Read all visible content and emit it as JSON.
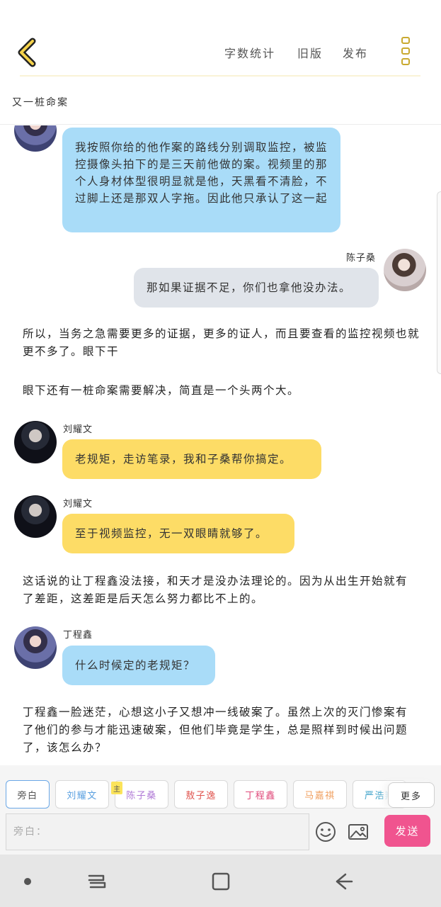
{
  "header": {
    "actions": [
      {
        "label": "字数统计"
      },
      {
        "label": "旧版"
      },
      {
        "label": "发布"
      }
    ],
    "subtitle": "又一桩命案"
  },
  "messages": [
    {
      "type": "bubble",
      "side": "left",
      "color": "blue",
      "avatar": "purple",
      "name": "",
      "text": "我按照你给的他作案的路线分别调取监控，被监控摄像头拍下的是三天前他做的案。视频里的那个人身材体型很明显就是他，天黑看不清脸，不过脚上还是那双人字拖。因此他只承认了这一起"
    },
    {
      "type": "bubble",
      "side": "right",
      "color": "grey",
      "avatar": "light",
      "name": "陈子桑",
      "text": "那如果证据不足，你们也拿他没办法。"
    },
    {
      "type": "narration",
      "text": "所以，当务之急需要更多的证据，更多的证人，而且要查看的监控视频也就更不多了。眼下干"
    },
    {
      "type": "narration",
      "text": "眼下还有一桩命案需要解决，简直是一个头两个大。"
    },
    {
      "type": "bubble",
      "side": "left",
      "color": "yellow",
      "avatar": "dark",
      "name": "刘耀文",
      "text": "老规矩，走访笔录，我和子桑帮你搞定。"
    },
    {
      "type": "bubble",
      "side": "left",
      "color": "yellow",
      "avatar": "dark",
      "name": "刘耀文",
      "text": "至于视频监控，无一双眼睛就够了。"
    },
    {
      "type": "narration",
      "text": "这话说的让丁程鑫没法接，和天才是没办法理论的。因为从出生开始就有了差距，这差距是后天怎么努力都比不上的。"
    },
    {
      "type": "bubble",
      "side": "left",
      "color": "blue",
      "avatar": "purple",
      "name": "丁程鑫",
      "text": "什么时候定的老规矩？"
    },
    {
      "type": "narration",
      "text": "丁程鑫一脸迷茫，心想这小子又想冲一线破案了。虽然上次的灭门惨案有了他们的参与才能迅速破案，但他们毕竟是学生，总是照样到时候出问题了，该怎么办？"
    }
  ],
  "roles": {
    "chips": [
      {
        "label": "旁白",
        "color": "#555555",
        "selected": true
      },
      {
        "label": "刘耀文",
        "color": "#5aa0e0",
        "selected": false
      },
      {
        "label": "陈子桑",
        "color": "#b07ad6",
        "selected": false
      },
      {
        "label": "敖子逸",
        "color": "#e0554f",
        "selected": false
      },
      {
        "label": "丁程鑫",
        "color": "#e04a7a",
        "selected": false
      },
      {
        "label": "马嘉祺",
        "color": "#f0a060",
        "selected": false
      },
      {
        "label": "严浩翔",
        "color": "#3aa0c8",
        "selected": false
      }
    ],
    "main_badge": "主",
    "more_label": "更多"
  },
  "composer": {
    "placeholder": "旁白：",
    "send_label": "发送"
  },
  "icons": [
    "back-chevron-icon",
    "more-vertical-icon",
    "emoji-icon",
    "image-icon",
    "recent-apps-icon",
    "home-icon",
    "back-icon"
  ],
  "colors": {
    "accent_yellow": "#fddc66",
    "bubble_blue": "#a9dcf8",
    "bubble_grey": "#e0e4ea",
    "send_pink": "#f0548f"
  }
}
